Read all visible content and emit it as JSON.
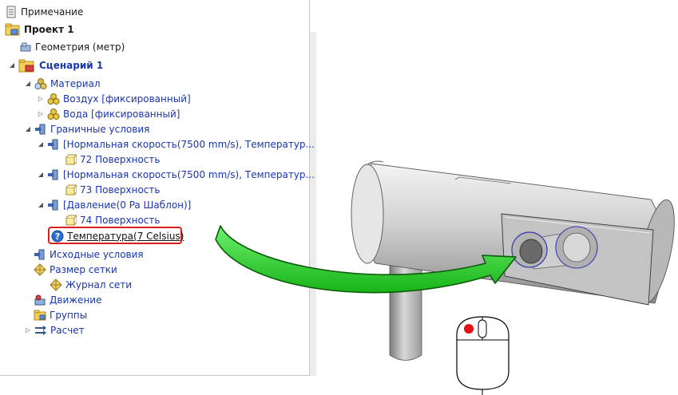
{
  "tree": {
    "note": "Примечание",
    "project": "Проект 1",
    "geometry": "Геометрия (метр)",
    "scenario": "Сценарий 1",
    "material": "Материал",
    "air": "Воздух [фиксированный]",
    "water": "Вода [фиксированный]",
    "boundary": "Граничные условия",
    "bc1": "[Нормальная скорость(7500 mm/s), Температур...",
    "surf72": "72 Поверхность",
    "bc2": "[Нормальная скорость(7500 mm/s), Температур...",
    "surf73": "73 Поверхность",
    "bc3": "[Давление(0 Pa Шаблон)]",
    "surf74": "74 Поверхность",
    "temperature": "Температура(7 Celsius)",
    "initial": "Исходные условия",
    "mesh": "Размер сетки",
    "meshlog": "Журнал сети",
    "motion": "Движение",
    "groups": "Группы",
    "calc": "Расчет"
  },
  "colors": {
    "tree_text_blue": "#1a35b0",
    "highlight_border": "#d81e1e",
    "arrow_green": "#2fd12f",
    "mouse_button": "#e81010"
  }
}
